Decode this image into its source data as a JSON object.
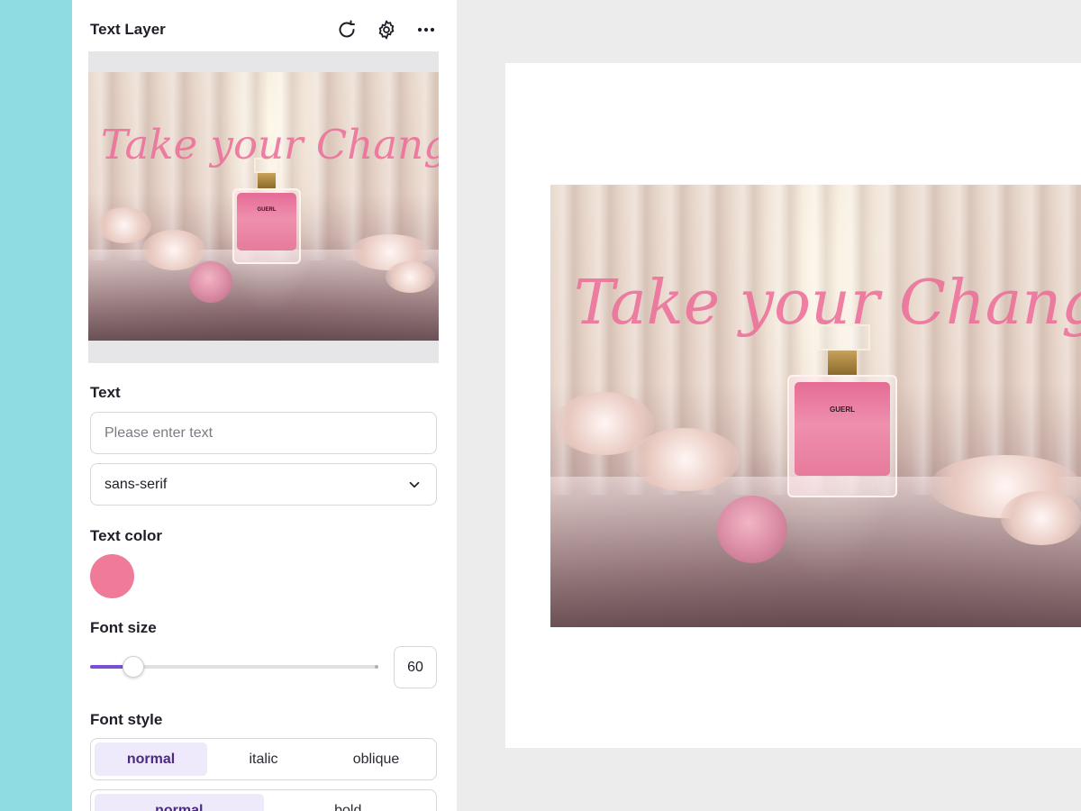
{
  "panel": {
    "title": "Text Layer",
    "icons": [
      "refresh-icon",
      "gear-icon",
      "more-icon"
    ]
  },
  "preview": {
    "overlay_text": "Take your Change",
    "bottle_label": "GUERL"
  },
  "text_section": {
    "label": "Text",
    "input_placeholder": "Please enter text",
    "input_value": "",
    "font_family_selected": "sans-serif"
  },
  "text_color": {
    "label": "Text color",
    "value": "#ef7b98"
  },
  "font_size": {
    "label": "Font size",
    "value": "60",
    "slider_fraction": 0.15,
    "accent": "#7a4fd6"
  },
  "font_style": {
    "label": "Font style",
    "options": [
      "normal",
      "italic",
      "oblique"
    ],
    "selected": "normal"
  },
  "font_weight": {
    "options": [
      "normal",
      "bold"
    ],
    "selected": "normal"
  },
  "canvas": {
    "overlay_text": "Take your Change",
    "bottle_label": "GUERL"
  }
}
